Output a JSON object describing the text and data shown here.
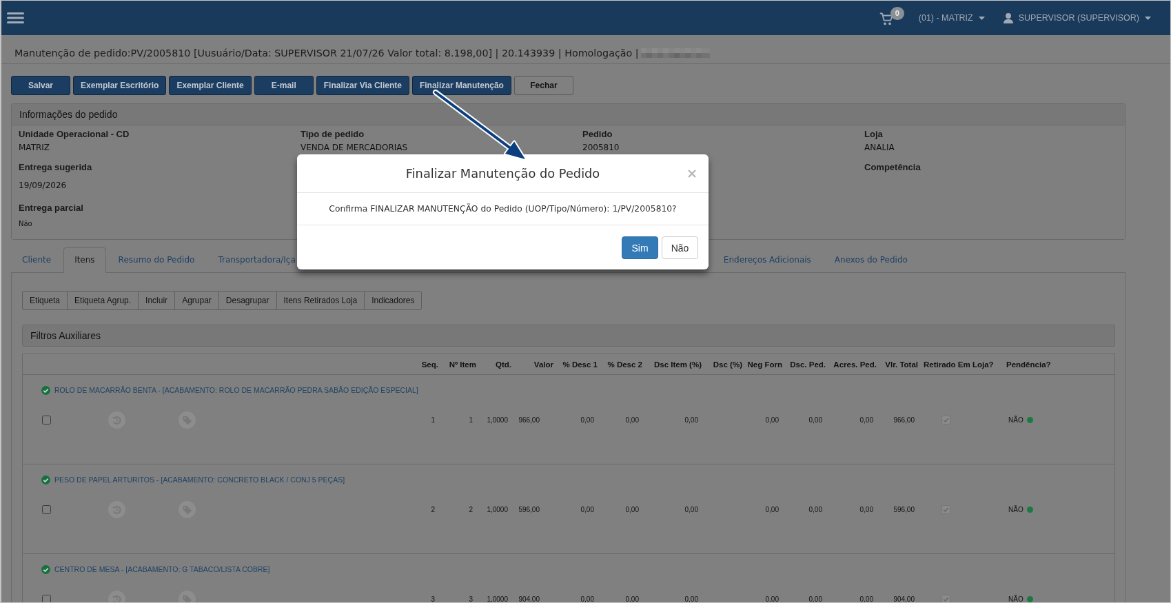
{
  "navbar": {
    "cart_count": "0",
    "unit": "(01) - MATRIZ",
    "user": "SUPERVISOR (SUPERVISOR)"
  },
  "page_title": "Manutenção de pedido:PV/2005810 [Uusuário/Data: SUPERVISOR 21/07/26 Valor total: 8.198,00] | 20.143939 | Homologação |",
  "actions": [
    {
      "label": "Salvar",
      "kind": "primary"
    },
    {
      "label": "Exemplar Escritório",
      "kind": "primary"
    },
    {
      "label": "Exemplar Cliente",
      "kind": "primary"
    },
    {
      "label": "E-mail",
      "kind": "primary"
    },
    {
      "label": "Finalizar Via Cliente",
      "kind": "primary"
    },
    {
      "label": "Finalizar Manutenção",
      "kind": "primary"
    },
    {
      "label": "Fechar",
      "kind": "default"
    }
  ],
  "order_info": {
    "title": "Informações do pedido",
    "rows": [
      [
        {
          "label": "Unidade Operacional - CD",
          "value": "MATRIZ"
        },
        {
          "label": "Tipo de pedido",
          "value": "VENDA DE MERCADORIAS"
        },
        {
          "label": "Pedido",
          "value": "2005810"
        },
        {
          "label": "Loja",
          "value": "ANALIA"
        }
      ],
      [
        {
          "label": "Entrega sugerida",
          "value": "19/09/2026"
        },
        null,
        null,
        {
          "label": "Competência"
        }
      ],
      [
        {
          "label": "Entrega parcial",
          "value": "Não"
        }
      ]
    ]
  },
  "tabs": [
    {
      "label": "Cliente",
      "selected": false
    },
    {
      "label": "Itens",
      "selected": true
    },
    {
      "label": "Resumo do Pedido",
      "selected": false
    },
    {
      "label": "Transportadora/Iça",
      "selected": false
    },
    {
      "label": "Endereços Adicionais",
      "selected": false
    },
    {
      "label": "Anexos do Pedido",
      "selected": false
    }
  ],
  "items_toolbar": [
    "Etiqueta",
    "Etiqueta Agrup.",
    "Incluir",
    "Agrupar",
    "Desagrupar",
    "Itens Retirados Loja",
    "Indicadores"
  ],
  "filters_panel": {
    "title": "Filtros Auxiliares"
  },
  "table": {
    "columns": [
      "Seq.",
      "Nº Item",
      "Qtd.",
      "Valor",
      "% Desc 1",
      "% Desc 2",
      "Dsc Item (%)",
      "Dsc (%)",
      "Neg Forn",
      "Dsc. Ped.",
      "Acres. Ped.",
      "Vlr. Total",
      "Retirado Em Loja?",
      "Pendência?"
    ],
    "items": [
      {
        "title": "ROLO DE MACARRÃO BENTA - [ACABAMENTO: ROLO DE MACARRÃO PEDRA SABÃO EDIÇÃO ESPECIAL]",
        "checked": false,
        "tools_enabled": false,
        "cells": [
          "1",
          "1",
          "1,0000",
          "966,00",
          "0,00",
          "0,00",
          "0,00",
          null,
          "0,00",
          "0,00",
          "0,00",
          "966,00"
        ],
        "withdrawn": {
          "checked": true,
          "disabled": true
        },
        "pending": {
          "text": "NÃO",
          "color": "#1a7a42"
        }
      },
      {
        "title": "PESO DE PAPEL ARTURITOS - [ACABAMENTO: CONCRETO BLACK / CONJ 5 PEÇAS]",
        "checked": false,
        "tools_enabled": false,
        "cells": [
          "2",
          "2",
          "1,0000",
          "596,00",
          "0,00",
          "0,00",
          "0,00",
          null,
          "0,00",
          "0,00",
          "0,00",
          "596,00"
        ],
        "withdrawn": {
          "checked": true,
          "disabled": true
        },
        "pending": {
          "text": "NÃO",
          "color": "#1a7a42"
        }
      },
      {
        "title": "CENTRO DE MESA - [ACABAMENTO: G TABACO/LISTA COBRE]",
        "checked": false,
        "tools_enabled": false,
        "cells": [
          "3",
          "3",
          "1,0000",
          "904,00",
          "0,00",
          "0,00",
          "0,00",
          null,
          "0,00",
          "0,00",
          "0,00",
          "904,00"
        ],
        "withdrawn": {
          "checked": true,
          "disabled": true
        },
        "pending": {
          "text": "NÃO",
          "color": "#1a7a42"
        }
      }
    ]
  },
  "modal": {
    "title": "Finalizar Manutenção do Pedido",
    "message": "Confirma FINALIZAR MANUTENÇÃO do Pedido (UOP/Tipo/Número): 1/PV/2005810?",
    "buttons": [
      {
        "label": "Sim",
        "kind": "primary"
      },
      {
        "label": "Não",
        "kind": "default"
      }
    ]
  }
}
